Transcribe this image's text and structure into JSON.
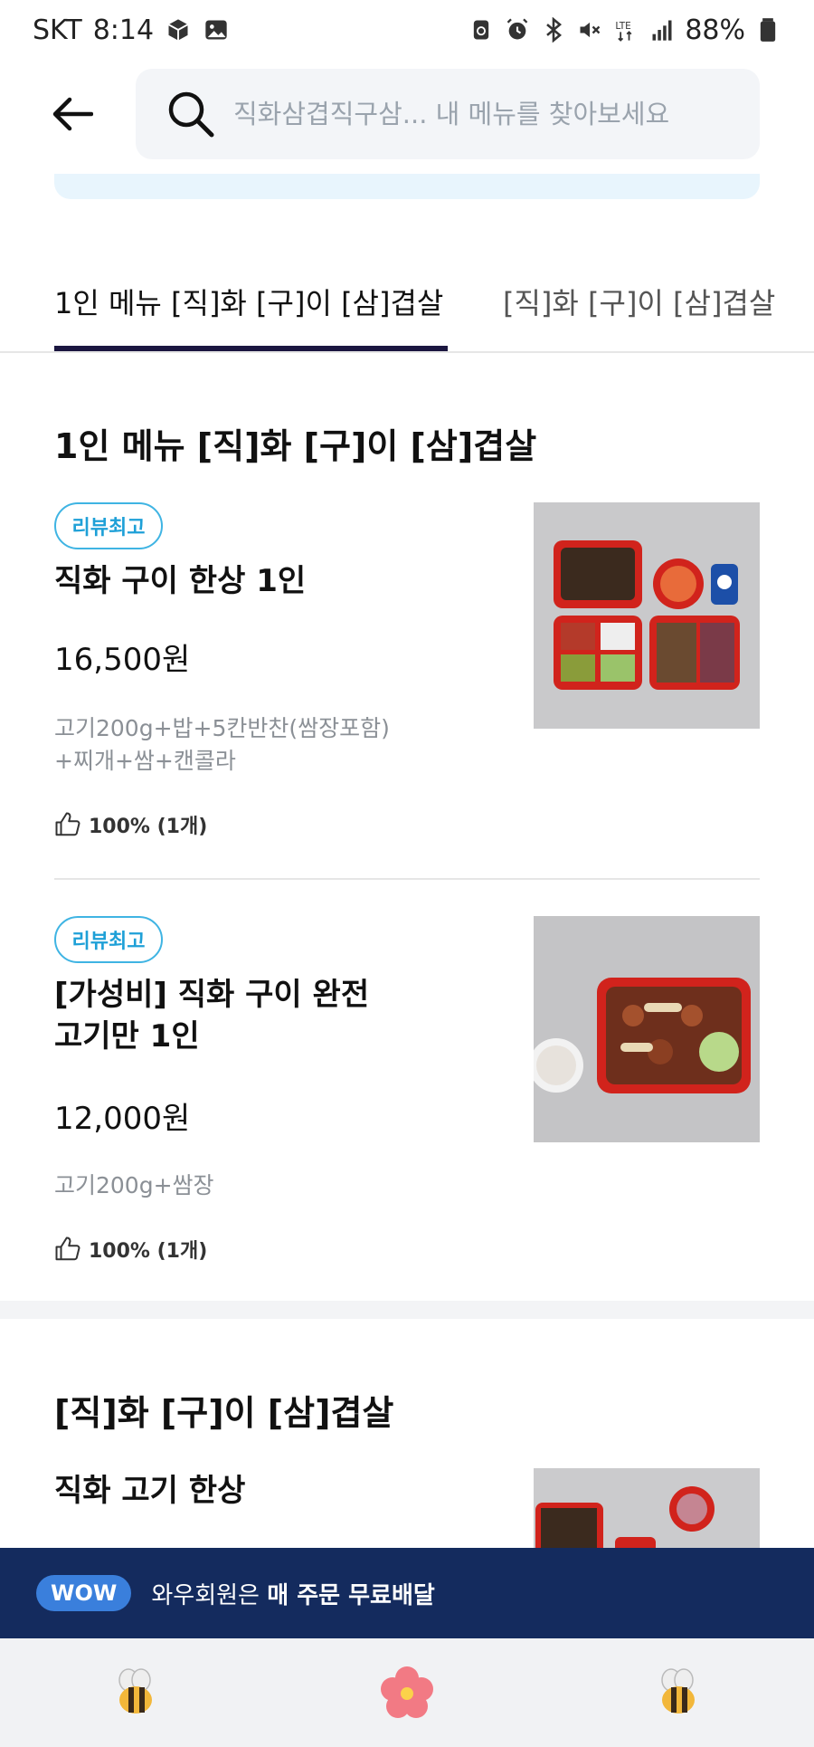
{
  "status_bar": {
    "carrier": "SKT",
    "time": "8:14",
    "battery": "88%",
    "icons_left": [
      "cube-icon",
      "gallery-icon"
    ],
    "icons_right": [
      "recycle-icon",
      "alarm-icon",
      "bluetooth-icon",
      "mute-icon",
      "lte-icon",
      "signal-icon",
      "battery-icon"
    ]
  },
  "search": {
    "placeholder": "직화삼겹직구삼... 내 메뉴를 찾아보세요"
  },
  "tabs": [
    {
      "label": "1인 메뉴 [직]화 [구]이 [삼]겹살",
      "active": true
    },
    {
      "label": "[직]화 [구]이 [삼]겹살",
      "active": false
    }
  ],
  "sections": [
    {
      "title": "1인 메뉴 [직]화 [구]이 [삼]겹살",
      "items": [
        {
          "badge": "리뷰최고",
          "name": "직화 구이 한상 1인",
          "price": "16,500원",
          "desc_line1": "고기200g+밥+5칸반찬(쌈장포함)",
          "desc_line2": "+찌개+쌈+캔콜라",
          "rating": "100% (1개)"
        },
        {
          "badge": "리뷰최고",
          "name_line1": "[가성비] 직화 구이 완전",
          "name_line2": "고기만 1인",
          "price": "12,000원",
          "desc_line1": "고기200g+쌈장",
          "rating": "100% (1개)"
        }
      ]
    },
    {
      "title": "[직]화 [구]이 [삼]겹살",
      "items": [
        {
          "name": "직화 고기 한상"
        }
      ]
    }
  ],
  "wow_banner": {
    "badge": "WOW",
    "text_prefix": "와우회원은 ",
    "text_bold": "매 주문 무료배달"
  },
  "bottom_nav": [
    "bee-icon",
    "flower-icon",
    "bee-icon"
  ],
  "colors": {
    "accent_navy": "#1b1640",
    "badge_blue": "#1ea0d7",
    "wow_banner": "#142b5e"
  }
}
